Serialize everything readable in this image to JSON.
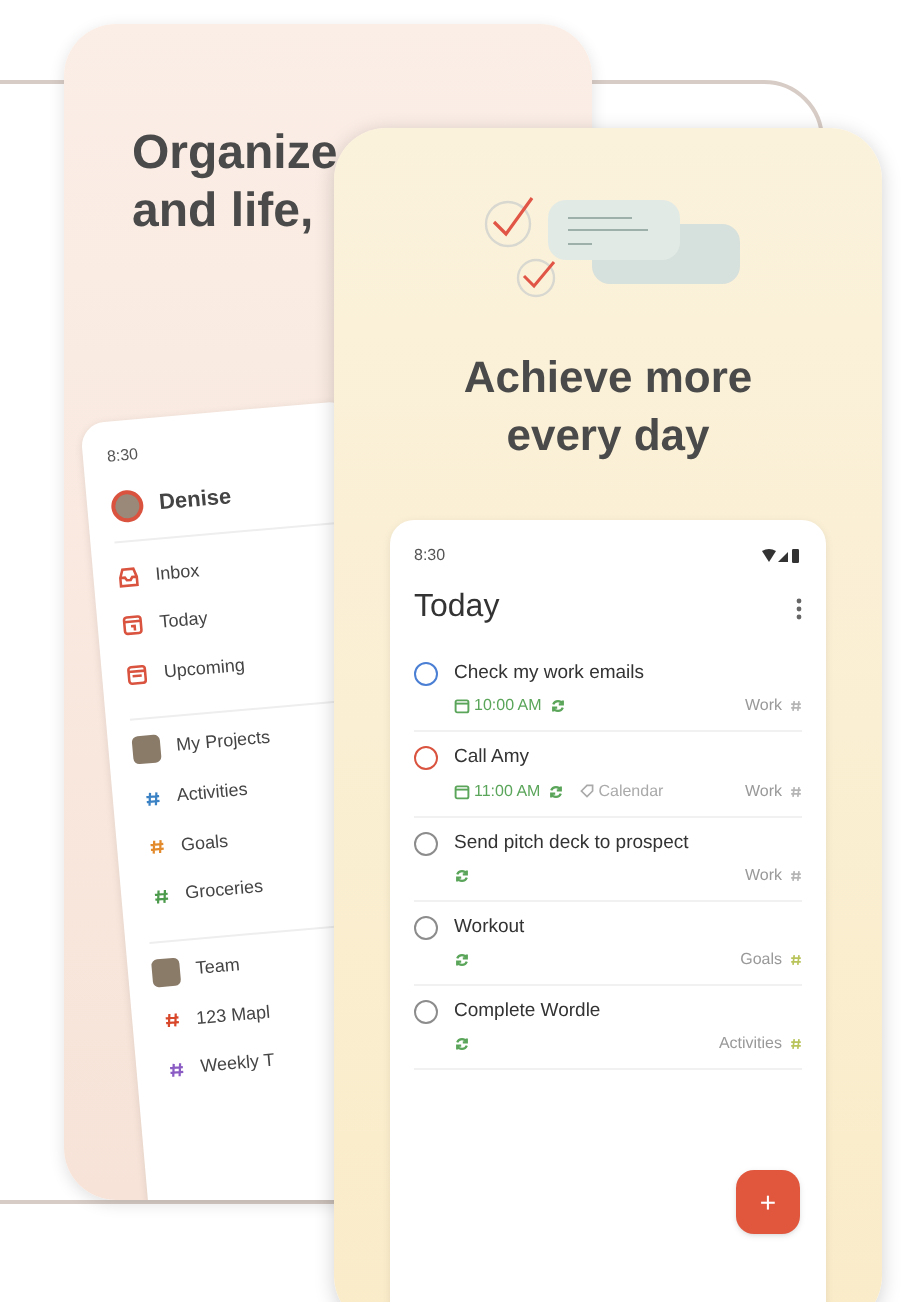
{
  "back_screen": {
    "headline": [
      "Organize",
      "and life,"
    ],
    "sidebar": {
      "time": "8:30",
      "user": "Denise",
      "items": [
        {
          "kind": "inbox",
          "label": "Inbox"
        },
        {
          "kind": "today",
          "label": "Today"
        },
        {
          "kind": "upcoming",
          "label": "Upcoming"
        },
        {
          "kind": "group",
          "label": "My Projects"
        },
        {
          "kind": "project",
          "label": "Activities",
          "color": "#3b82c4"
        },
        {
          "kind": "project",
          "label": "Goals",
          "color": "#e38b2c"
        },
        {
          "kind": "project",
          "label": "Groceries",
          "color": "#4c9a4c"
        },
        {
          "kind": "group",
          "label": "Team"
        },
        {
          "kind": "project",
          "label": "123 Mapl",
          "color": "#d9472b"
        },
        {
          "kind": "project",
          "label": "Weekly T",
          "color": "#8a5cc4"
        }
      ]
    }
  },
  "front_screen": {
    "headline": [
      "Achieve more",
      "every day"
    ],
    "status_time": "8:30",
    "title": "Today",
    "tasks": [
      {
        "title": "Check my work emails",
        "color": "#4a7fd4",
        "time": "10:00 AM",
        "recurring": true,
        "project": {
          "name": "Work",
          "color": "#b5b5b5"
        }
      },
      {
        "title": "Call Amy",
        "color": "#d9533f",
        "time": "11:00 AM",
        "recurring": true,
        "label": "Calendar",
        "project": {
          "name": "Work",
          "color": "#b5b5b5"
        }
      },
      {
        "title": "Send pitch deck to prospect",
        "color": "#8c8c8c",
        "recurring": true,
        "project": {
          "name": "Work",
          "color": "#b5b5b5"
        }
      },
      {
        "title": "Workout",
        "color": "#8c8c8c",
        "recurring": true,
        "project": {
          "name": "Goals",
          "color": "#b9c45a"
        }
      },
      {
        "title": "Complete Wordle",
        "color": "#8c8c8c",
        "recurring": true,
        "project": {
          "name": "Activities",
          "color": "#b9c45a"
        }
      }
    ],
    "add_button": "+"
  }
}
